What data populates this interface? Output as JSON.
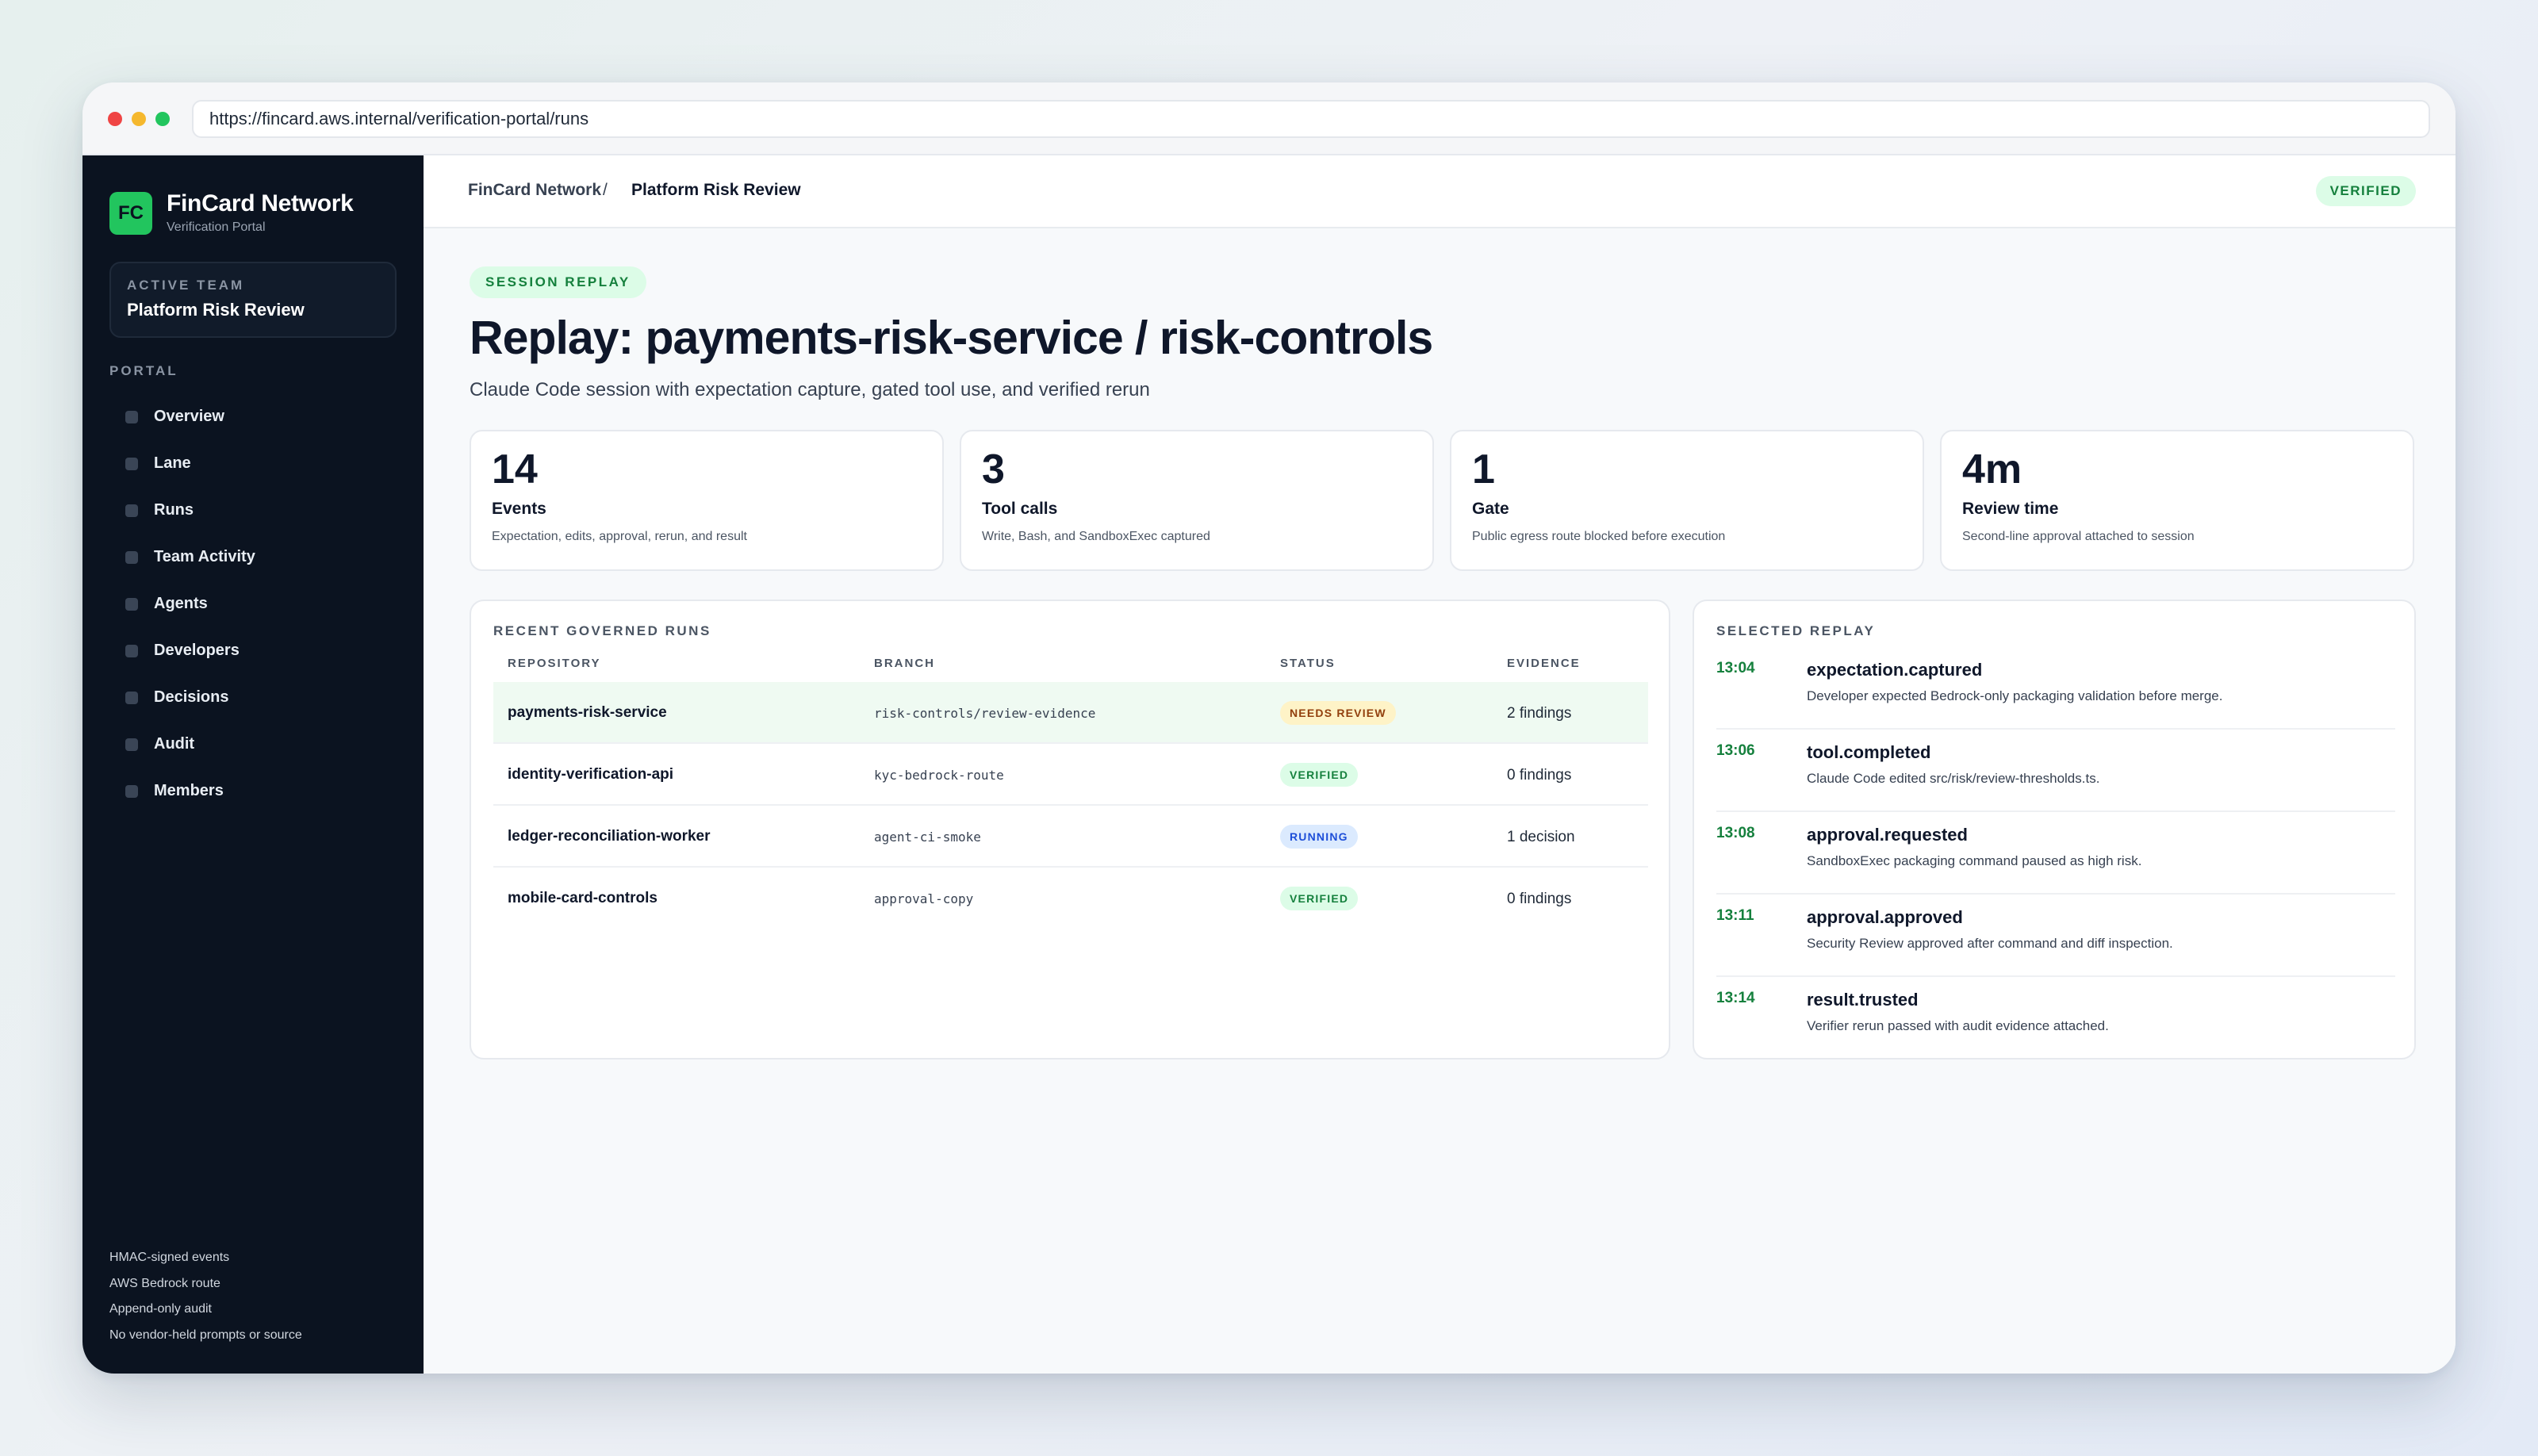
{
  "browser": {
    "url": "https://fincard.aws.internal/verification-portal/runs"
  },
  "sidebar": {
    "logo": "FC",
    "brand_name": "FinCard Network",
    "brand_sub": "Verification Portal",
    "team_label": "ACTIVE TEAM",
    "team_name": "Platform Risk Review",
    "portal_label": "PORTAL",
    "items": [
      {
        "label": "Overview"
      },
      {
        "label": "Lane"
      },
      {
        "label": "Runs"
      },
      {
        "label": "Team Activity"
      },
      {
        "label": "Agents"
      },
      {
        "label": "Developers"
      },
      {
        "label": "Decisions"
      },
      {
        "label": "Audit"
      },
      {
        "label": "Members"
      }
    ],
    "footer": [
      "HMAC-signed events",
      "AWS Bedrock route",
      "Append-only audit",
      "No vendor-held prompts or source"
    ]
  },
  "header": {
    "crumb_root": "FinCard Network",
    "crumb_sep": "/",
    "crumb_current": "Platform Risk Review",
    "status": "VERIFIED"
  },
  "page": {
    "pill": "SESSION REPLAY",
    "title": "Replay: payments-risk-service / risk-controls",
    "subtitle": "Claude Code session with expectation capture, gated tool use, and verified rerun"
  },
  "stats": [
    {
      "value": "14",
      "label": "Events",
      "desc": "Expectation, edits, approval, rerun, and result"
    },
    {
      "value": "3",
      "label": "Tool calls",
      "desc": "Write, Bash, and SandboxExec captured"
    },
    {
      "value": "1",
      "label": "Gate",
      "desc": "Public egress route blocked before execution"
    },
    {
      "value": "4m",
      "label": "Review time",
      "desc": "Second-line approval attached to session"
    }
  ],
  "runs": {
    "title": "RECENT GOVERNED RUNS",
    "columns": [
      "REPOSITORY",
      "BRANCH",
      "STATUS",
      "EVIDENCE"
    ],
    "rows": [
      {
        "repo": "payments-risk-service",
        "branch": "risk-controls/review-evidence",
        "status": "NEEDS REVIEW",
        "evidence": "2 findings"
      },
      {
        "repo": "identity-verification-api",
        "branch": "kyc-bedrock-route",
        "status": "VERIFIED",
        "evidence": "0 findings"
      },
      {
        "repo": "ledger-reconciliation-worker",
        "branch": "agent-ci-smoke",
        "status": "RUNNING",
        "evidence": "1 decision"
      },
      {
        "repo": "mobile-card-controls",
        "branch": "approval-copy",
        "status": "VERIFIED",
        "evidence": "0 findings"
      }
    ]
  },
  "replay": {
    "title": "SELECTED REPLAY",
    "events": [
      {
        "time": "13:04",
        "name": "expectation.captured",
        "desc": "Developer expected Bedrock-only packaging validation before merge."
      },
      {
        "time": "13:06",
        "name": "tool.completed",
        "desc": "Claude Code edited src/risk/review-thresholds.ts."
      },
      {
        "time": "13:08",
        "name": "approval.requested",
        "desc": "SandboxExec packaging command paused as high risk."
      },
      {
        "time": "13:11",
        "name": "approval.approved",
        "desc": "Security Review approved after command and diff inspection."
      },
      {
        "time": "13:14",
        "name": "result.trusted",
        "desc": "Verifier rerun passed with audit evidence attached."
      }
    ]
  }
}
